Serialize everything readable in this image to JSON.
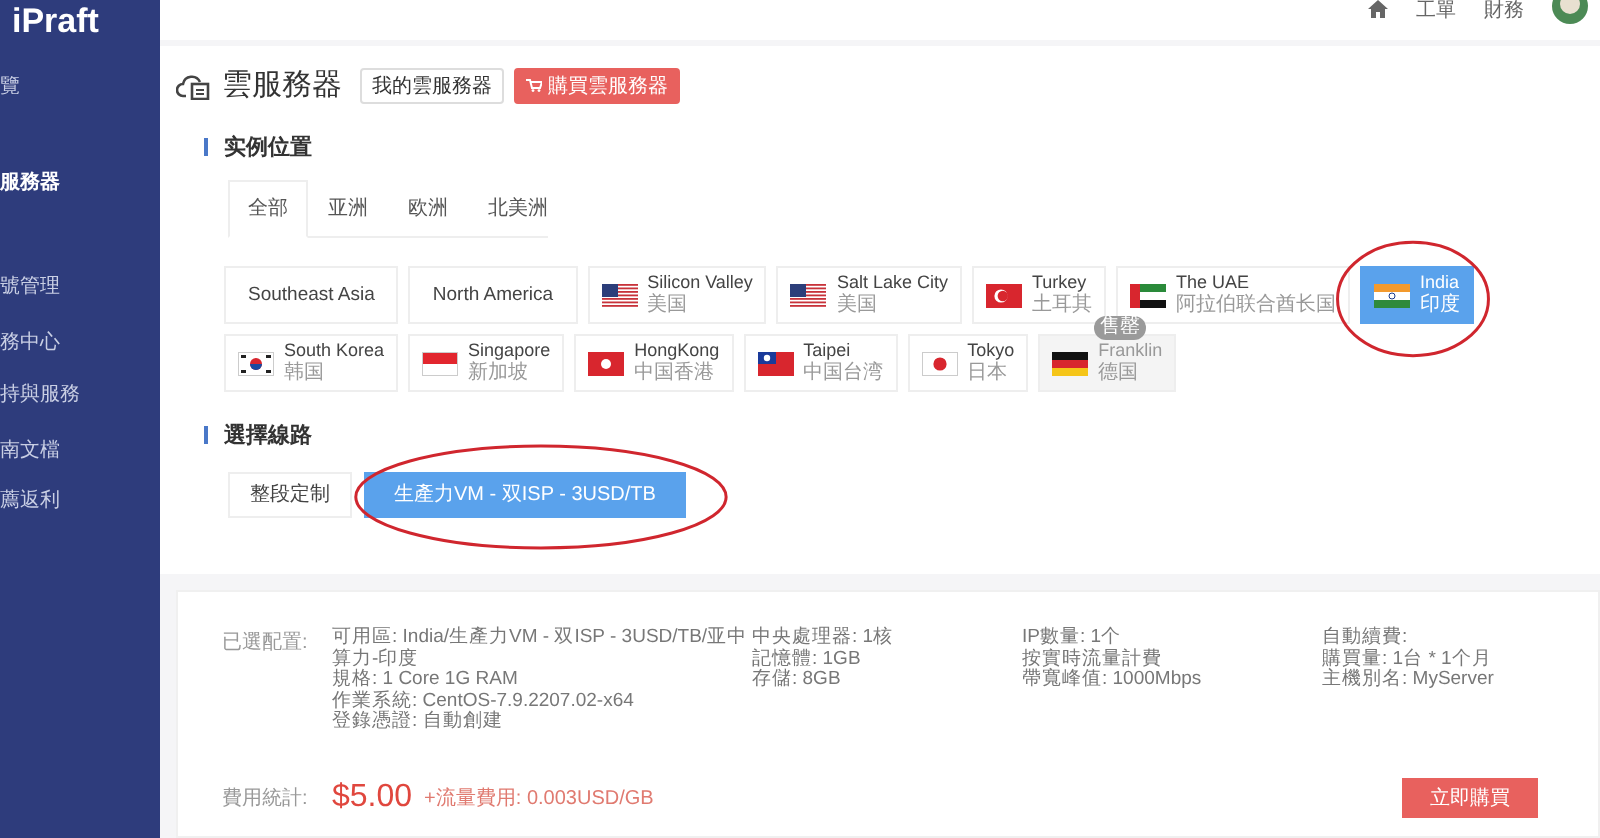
{
  "brand": {
    "logo": "iPraft"
  },
  "sidebar": {
    "items": [
      {
        "label": "覽",
        "selected": false
      },
      {
        "label": "服務器",
        "selected": true
      },
      {
        "label": "號管理",
        "selected": false
      },
      {
        "label": "務中心",
        "selected": false
      },
      {
        "label": "持與服務",
        "selected": false
      },
      {
        "label": "南文檔",
        "selected": false
      },
      {
        "label": "薦返利",
        "selected": false
      }
    ]
  },
  "header": {
    "links": [
      "工單",
      "財務"
    ]
  },
  "page": {
    "title": "雲服務器",
    "buttons": [
      {
        "label": "我的雲服務器",
        "kind": "plain"
      },
      {
        "label": "購買雲服務器",
        "kind": "primary"
      }
    ]
  },
  "location": {
    "heading": "实例位置",
    "tabs": [
      {
        "label": "全部",
        "selected": true
      },
      {
        "label": "亚洲",
        "selected": false
      },
      {
        "label": "欧洲",
        "selected": false
      },
      {
        "label": "北美洲",
        "selected": false
      }
    ],
    "rows": [
      [
        {
          "name": "Southeast Asia",
          "kind": "plain",
          "selected": false,
          "disabled": false
        },
        {
          "name": "North America",
          "kind": "plain",
          "selected": false,
          "disabled": false
        },
        {
          "name": "Silicon Valley",
          "sub": "美国",
          "kind": "flag",
          "selected": false,
          "disabled": false
        },
        {
          "name": "Salt Lake City",
          "sub": "美国",
          "kind": "flag",
          "selected": false,
          "disabled": false
        },
        {
          "name": "Turkey",
          "sub": "土耳其",
          "kind": "flag",
          "selected": false,
          "disabled": false
        },
        {
          "name": "The UAE",
          "sub": "阿拉伯联合酋长国",
          "kind": "flag",
          "selected": false,
          "disabled": false
        },
        {
          "name": "India",
          "sub": "印度",
          "kind": "flag",
          "selected": true,
          "disabled": false
        }
      ],
      [
        {
          "name": "South Korea",
          "sub": "韩国",
          "kind": "flag",
          "selected": false,
          "disabled": false
        },
        {
          "name": "Singapore",
          "sub": "新加坡",
          "kind": "flag",
          "selected": false,
          "disabled": false
        },
        {
          "name": "HongKong",
          "sub": "中国香港",
          "kind": "flag",
          "selected": false,
          "disabled": false
        },
        {
          "name": "Taipei",
          "sub": "中国台湾",
          "kind": "flag",
          "selected": false,
          "disabled": false
        },
        {
          "name": "Tokyo",
          "sub": "日本",
          "kind": "flag",
          "selected": false,
          "disabled": false
        },
        {
          "name": "Franklin",
          "sub": "德国",
          "kind": "flag",
          "selected": false,
          "disabled": true,
          "badge": "售罄"
        }
      ]
    ]
  },
  "line": {
    "heading": "選擇線路",
    "options": [
      {
        "label": "整段定制",
        "selected": false
      },
      {
        "label": "生產力VM - 双ISP - 3USD/TB",
        "selected": true
      }
    ]
  },
  "summary": {
    "config_label": "已選配置:",
    "columns": [
      [
        "可用區: India/生產力VM - 双ISP - 3USD/TB/亚中算力-印度",
        "規格: 1 Core 1G RAM",
        "作業系統: CentOS-7.9.2207.02-x64",
        "登錄憑證: 自動創建"
      ],
      [
        "中央處理器: 1核",
        "記憶體: 1GB",
        "存儲: 8GB"
      ],
      [
        "IP數量: 1个",
        "按實時流量計費",
        "帶寬峰值: 1000Mbps"
      ],
      [
        "自動續費:",
        "購買量: 1台 * 1个月",
        "主機別名: MyServer"
      ]
    ],
    "cost_label": "費用統計:",
    "price": "$5.00",
    "traffic": "+流量費用: 0.003USD/GB",
    "buy_button": "立即購買"
  }
}
